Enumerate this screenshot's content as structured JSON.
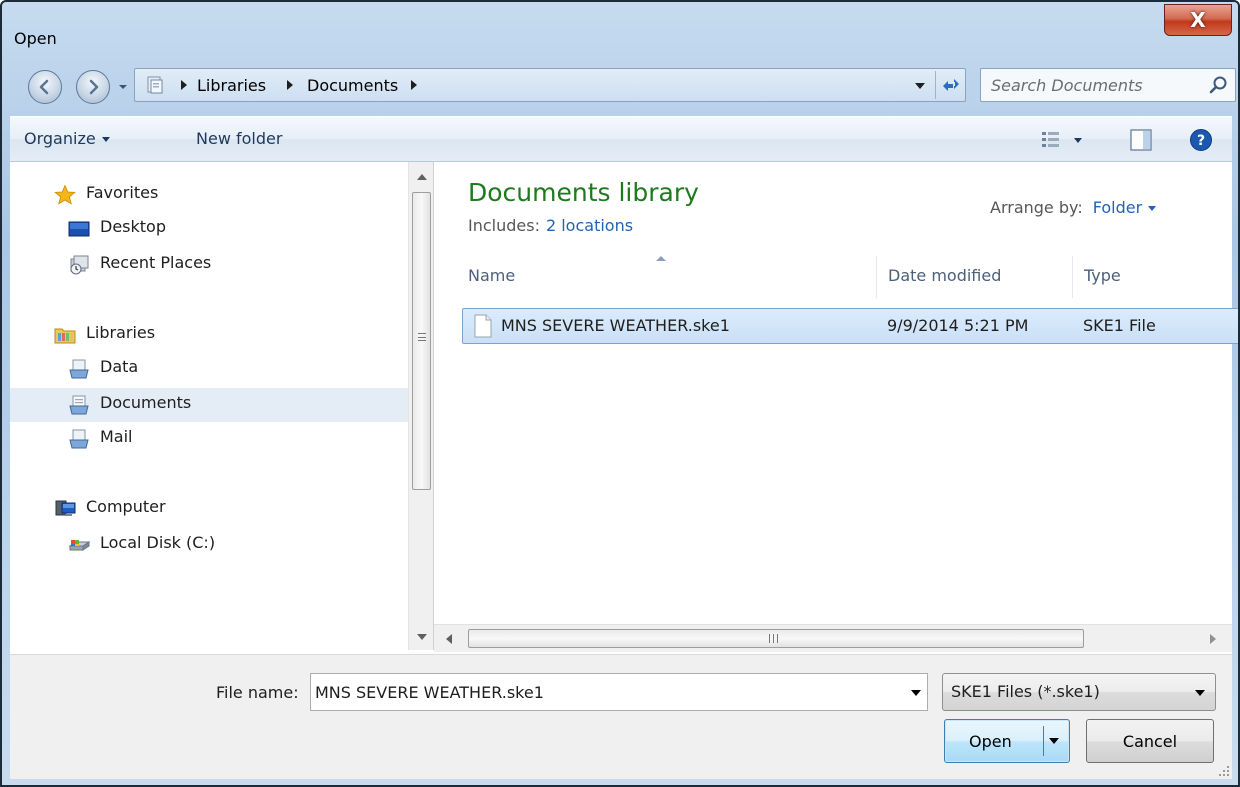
{
  "window": {
    "title": "Open",
    "close_label": "X"
  },
  "address_bar": {
    "crumbs": [
      "Libraries",
      "Documents"
    ],
    "search_placeholder": "Search Documents"
  },
  "toolbar": {
    "organize_label": "Organize",
    "new_folder_label": "New folder"
  },
  "nav_pane": {
    "items": [
      {
        "label": "Favorites",
        "icon": "star-icon"
      },
      {
        "label": "Desktop",
        "icon": "desktop-icon"
      },
      {
        "label": "Recent Places",
        "icon": "recent-places-icon"
      },
      {
        "label": "Libraries",
        "icon": "libraries-icon"
      },
      {
        "label": "Data",
        "icon": "library-folder-icon"
      },
      {
        "label": "Documents",
        "icon": "documents-library-icon",
        "selected": true
      },
      {
        "label": "Mail",
        "icon": "library-folder-icon"
      },
      {
        "label": "Computer",
        "icon": "computer-icon"
      },
      {
        "label": "Local Disk (C:)",
        "icon": "local-disk-icon"
      }
    ]
  },
  "content": {
    "library_title": "Documents library",
    "includes_label": "Includes:",
    "includes_link": "2 locations",
    "arrange_label": "Arrange by:",
    "arrange_value": "Folder",
    "columns": [
      "Name",
      "Date modified",
      "Type"
    ],
    "files": [
      {
        "name": "MNS SEVERE WEATHER.ske1",
        "date_modified": "9/9/2014 5:21 PM",
        "type": "SKE1 File",
        "selected": true
      }
    ],
    "hscroll_grip": "III"
  },
  "bottom": {
    "file_name_label": "File name:",
    "file_name_value": "MNS SEVERE WEATHER.ske1",
    "file_type_value": "SKE1 Files (*.ske1)",
    "open_label": "Open",
    "cancel_label": "Cancel"
  },
  "colors": {
    "accent_green": "#1e7a1e",
    "link_blue": "#1f63b5",
    "selection": "#c9e0f7",
    "close_red": "#c0391c"
  }
}
